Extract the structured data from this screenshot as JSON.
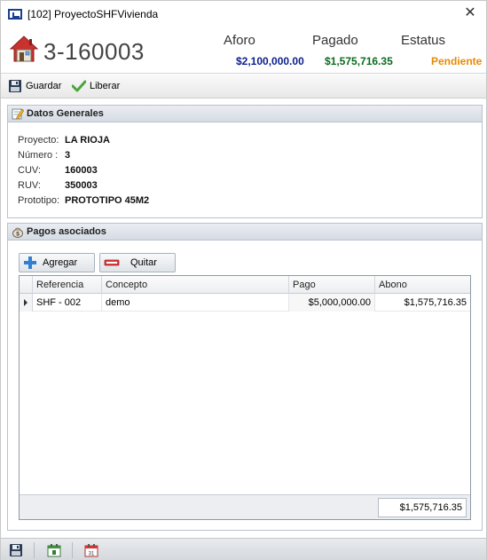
{
  "window": {
    "title": "[102] ProyectoSHFVivienda",
    "close_glyph": "✕",
    "icons": {
      "app": "app-logo-icon",
      "close": "close-icon"
    }
  },
  "header": {
    "project_number": "3-160003",
    "icon": "house-icon",
    "summary": {
      "aforo_label": "Aforo",
      "aforo_value": "$2,100,000.00",
      "pagado_label": "Pagado",
      "pagado_value": "$1,575,716.35",
      "estatus_label": "Estatus",
      "estatus_value": "Pendiente"
    },
    "colors": {
      "aforo": "#0a1e8c",
      "pagado": "#0a6b1e",
      "estatus": "#e88a00"
    }
  },
  "toolbar": {
    "save_label": "Guardar",
    "release_label": "Liberar",
    "icons": {
      "save": "floppy-disk-icon",
      "release": "checkmark-icon"
    }
  },
  "general": {
    "title": "Datos Generales",
    "icon": "edit-document-icon",
    "fields": [
      {
        "label": "Proyecto:",
        "value": "LA RIOJA"
      },
      {
        "label": "Número :",
        "value": "3"
      },
      {
        "label": "CUV:",
        "value": "160003"
      },
      {
        "label": "RUV:",
        "value": "350003"
      },
      {
        "label": "Prototipo:",
        "value": "PROTOTIPO 45M2"
      }
    ]
  },
  "payments": {
    "title": "Pagos asociados",
    "icon": "money-bag-icon",
    "add_label": "Agregar",
    "remove_label": "Quitar",
    "columns": [
      "Referencia",
      "Concepto",
      "Pago",
      "Abono"
    ],
    "rows": [
      {
        "referencia": "SHF - 002",
        "concepto": "demo",
        "pago": "$5,000,000.00",
        "abono": "$1,575,716.35"
      }
    ],
    "total": "$1,575,716.35"
  },
  "statusbar": {
    "icons": [
      "floppy-disk-icon",
      "calendar-icon",
      "calendar-31-icon"
    ]
  }
}
